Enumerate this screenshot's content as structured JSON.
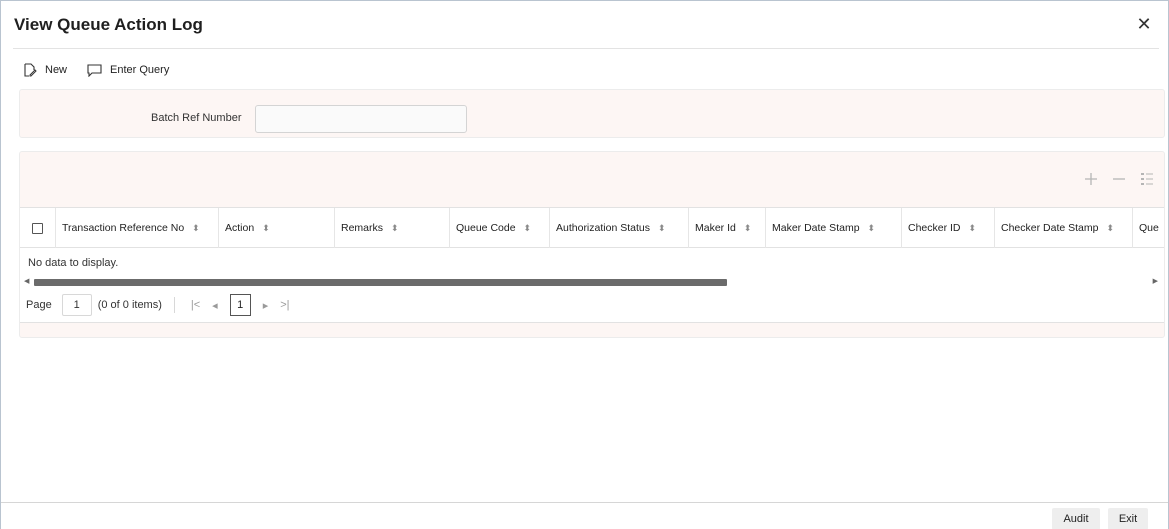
{
  "window": {
    "title": "View Queue Action Log"
  },
  "toolbar": {
    "new_label": "New",
    "enter_query_label": "Enter Query"
  },
  "query": {
    "batch_ref_label": "Batch Ref Number",
    "batch_ref_value": ""
  },
  "grid": {
    "columns": [
      "Transaction Reference No",
      "Action",
      "Remarks",
      "Queue Code",
      "Authorization Status",
      "Maker Id",
      "Maker Date Stamp",
      "Checker ID",
      "Checker Date Stamp",
      "Que"
    ],
    "empty_message": "No data to display.",
    "scroll_fraction": 0.62
  },
  "pager": {
    "page_label": "Page",
    "page_value": "1",
    "items_summary": "(0 of 0 items)",
    "current_page": "1"
  },
  "footer": {
    "audit_label": "Audit",
    "exit_label": "Exit"
  },
  "icons": {
    "close": "close-icon",
    "new": "new-document-icon",
    "enter_query": "speech-bubble-icon",
    "add_row": "plus-icon",
    "remove_row": "minus-icon",
    "columns": "column-list-icon",
    "sort": "sort-icon"
  },
  "colors": {
    "panel_bg": "#fdf6f4",
    "scroll_thumb": "#6b6b6b"
  }
}
